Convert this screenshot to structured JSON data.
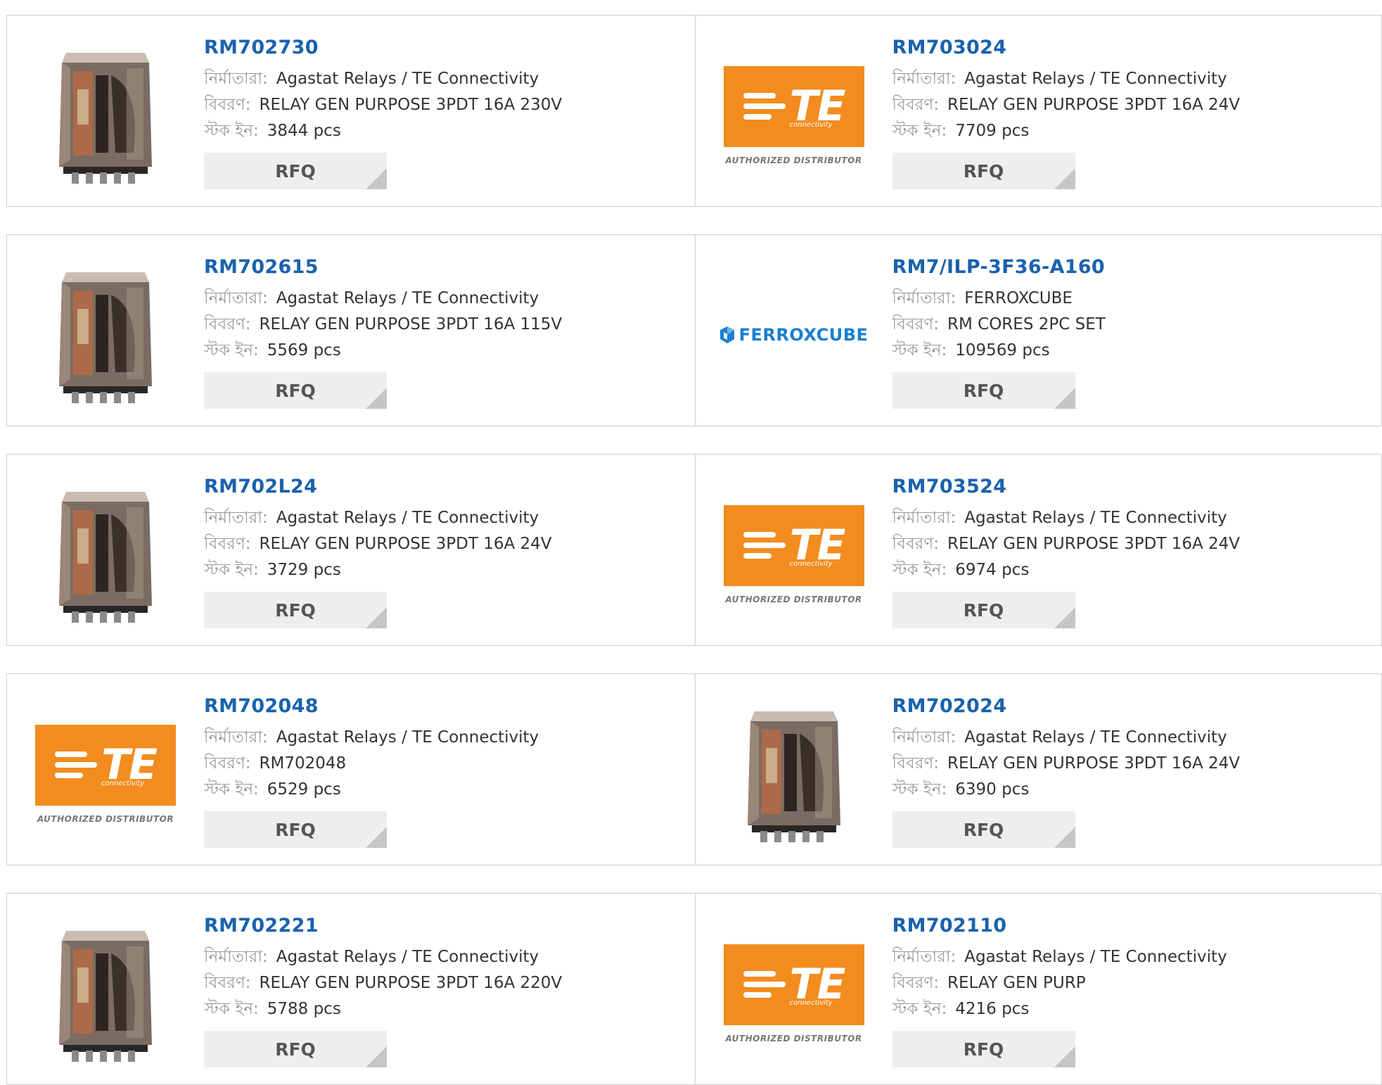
{
  "labels": {
    "manufacturer": "নির্মাতারা:",
    "description": "বিবরণ:",
    "stock": "স্টক ইন:"
  },
  "rows": [
    {
      "left": {
        "part": "RM702730",
        "image": "relay",
        "manufacturer": "Agastat Relays / TE Connectivity",
        "description": "RELAY GEN PURPOSE 3PDT 16A 230V",
        "stock": "3844 pcs",
        "rfq": "RFQ"
      },
      "right": {
        "part": "RM703024",
        "image": "te-logo",
        "manufacturer": "Agastat Relays / TE Connectivity",
        "description": "RELAY GEN PURPOSE 3PDT 16A 24V",
        "stock": "7709 pcs",
        "rfq": "RFQ"
      }
    },
    {
      "left": {
        "part": "RM702615",
        "image": "relay",
        "manufacturer": "Agastat Relays / TE Connectivity",
        "description": "RELAY GEN PURPOSE 3PDT 16A 115V",
        "stock": "5569 pcs",
        "rfq": "RFQ"
      },
      "right": {
        "part": "RM7/ILP-3F36-A160",
        "image": "ferroxcube-logo",
        "manufacturer": "FERROXCUBE",
        "description": "RM CORES 2PC SET",
        "stock": "109569 pcs",
        "rfq": "RFQ"
      }
    },
    {
      "left": {
        "part": "RM702L24",
        "image": "relay",
        "manufacturer": "Agastat Relays / TE Connectivity",
        "description": "RELAY GEN PURPOSE 3PDT 16A 24V",
        "stock": "3729 pcs",
        "rfq": "RFQ"
      },
      "right": {
        "part": "RM703524",
        "image": "te-logo",
        "manufacturer": "Agastat Relays / TE Connectivity",
        "description": "RELAY GEN PURPOSE 3PDT 16A 24V",
        "stock": "6974 pcs",
        "rfq": "RFQ"
      }
    },
    {
      "left": {
        "part": "RM702048",
        "image": "te-logo",
        "manufacturer": "Agastat Relays / TE Connectivity",
        "description": "RM702048",
        "stock": "6529 pcs",
        "rfq": "RFQ"
      },
      "right": {
        "part": "RM702024",
        "image": "relay",
        "manufacturer": "Agastat Relays / TE Connectivity",
        "description": "RELAY GEN PURPOSE 3PDT 16A 24V",
        "stock": "6390 pcs",
        "rfq": "RFQ"
      }
    },
    {
      "left": {
        "part": "RM702221",
        "image": "relay",
        "manufacturer": "Agastat Relays / TE Connectivity",
        "description": "RELAY GEN PURPOSE 3PDT 16A 220V",
        "stock": "5788 pcs",
        "rfq": "RFQ"
      },
      "right": {
        "part": "RM702110",
        "image": "te-logo",
        "manufacturer": "Agastat Relays / TE Connectivity",
        "description": "RELAY GEN PURP",
        "stock": "4216 pcs",
        "rfq": "RFQ"
      }
    }
  ],
  "te_logo": {
    "mark": "TE",
    "tagline": "connectivity",
    "badge": "AUTHORIZED DISTRIBUTOR",
    "color": "#f28c1e"
  },
  "ferroxcube_logo": {
    "text": "FERROXCUBE",
    "color": "#1a7fd0"
  },
  "colors": {
    "link": "#1a62ad",
    "label": "#9a9a9a",
    "rfq_bg": "#eeeeee"
  }
}
